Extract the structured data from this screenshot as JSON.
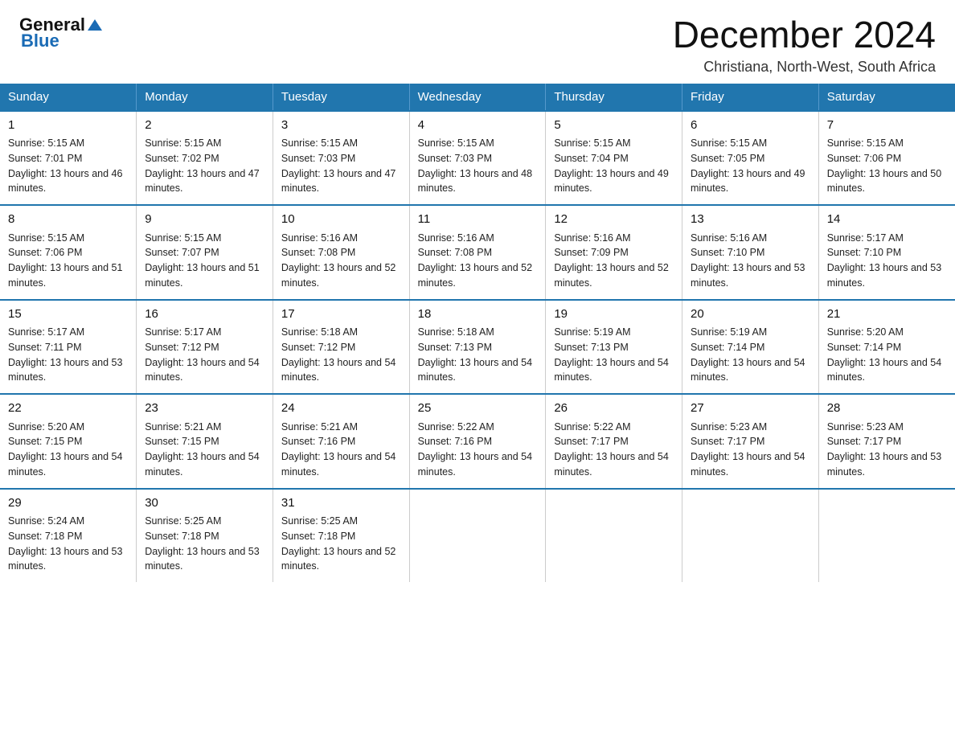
{
  "header": {
    "logo_general": "General",
    "logo_blue": "Blue",
    "title": "December 2024",
    "subtitle": "Christiana, North-West, South Africa"
  },
  "calendar": {
    "days_of_week": [
      "Sunday",
      "Monday",
      "Tuesday",
      "Wednesday",
      "Thursday",
      "Friday",
      "Saturday"
    ],
    "weeks": [
      [
        {
          "day": "1",
          "sunrise": "5:15 AM",
          "sunset": "7:01 PM",
          "daylight": "13 hours and 46 minutes."
        },
        {
          "day": "2",
          "sunrise": "5:15 AM",
          "sunset": "7:02 PM",
          "daylight": "13 hours and 47 minutes."
        },
        {
          "day": "3",
          "sunrise": "5:15 AM",
          "sunset": "7:03 PM",
          "daylight": "13 hours and 47 minutes."
        },
        {
          "day": "4",
          "sunrise": "5:15 AM",
          "sunset": "7:03 PM",
          "daylight": "13 hours and 48 minutes."
        },
        {
          "day": "5",
          "sunrise": "5:15 AM",
          "sunset": "7:04 PM",
          "daylight": "13 hours and 49 minutes."
        },
        {
          "day": "6",
          "sunrise": "5:15 AM",
          "sunset": "7:05 PM",
          "daylight": "13 hours and 49 minutes."
        },
        {
          "day": "7",
          "sunrise": "5:15 AM",
          "sunset": "7:06 PM",
          "daylight": "13 hours and 50 minutes."
        }
      ],
      [
        {
          "day": "8",
          "sunrise": "5:15 AM",
          "sunset": "7:06 PM",
          "daylight": "13 hours and 51 minutes."
        },
        {
          "day": "9",
          "sunrise": "5:15 AM",
          "sunset": "7:07 PM",
          "daylight": "13 hours and 51 minutes."
        },
        {
          "day": "10",
          "sunrise": "5:16 AM",
          "sunset": "7:08 PM",
          "daylight": "13 hours and 52 minutes."
        },
        {
          "day": "11",
          "sunrise": "5:16 AM",
          "sunset": "7:08 PM",
          "daylight": "13 hours and 52 minutes."
        },
        {
          "day": "12",
          "sunrise": "5:16 AM",
          "sunset": "7:09 PM",
          "daylight": "13 hours and 52 minutes."
        },
        {
          "day": "13",
          "sunrise": "5:16 AM",
          "sunset": "7:10 PM",
          "daylight": "13 hours and 53 minutes."
        },
        {
          "day": "14",
          "sunrise": "5:17 AM",
          "sunset": "7:10 PM",
          "daylight": "13 hours and 53 minutes."
        }
      ],
      [
        {
          "day": "15",
          "sunrise": "5:17 AM",
          "sunset": "7:11 PM",
          "daylight": "13 hours and 53 minutes."
        },
        {
          "day": "16",
          "sunrise": "5:17 AM",
          "sunset": "7:12 PM",
          "daylight": "13 hours and 54 minutes."
        },
        {
          "day": "17",
          "sunrise": "5:18 AM",
          "sunset": "7:12 PM",
          "daylight": "13 hours and 54 minutes."
        },
        {
          "day": "18",
          "sunrise": "5:18 AM",
          "sunset": "7:13 PM",
          "daylight": "13 hours and 54 minutes."
        },
        {
          "day": "19",
          "sunrise": "5:19 AM",
          "sunset": "7:13 PM",
          "daylight": "13 hours and 54 minutes."
        },
        {
          "day": "20",
          "sunrise": "5:19 AM",
          "sunset": "7:14 PM",
          "daylight": "13 hours and 54 minutes."
        },
        {
          "day": "21",
          "sunrise": "5:20 AM",
          "sunset": "7:14 PM",
          "daylight": "13 hours and 54 minutes."
        }
      ],
      [
        {
          "day": "22",
          "sunrise": "5:20 AM",
          "sunset": "7:15 PM",
          "daylight": "13 hours and 54 minutes."
        },
        {
          "day": "23",
          "sunrise": "5:21 AM",
          "sunset": "7:15 PM",
          "daylight": "13 hours and 54 minutes."
        },
        {
          "day": "24",
          "sunrise": "5:21 AM",
          "sunset": "7:16 PM",
          "daylight": "13 hours and 54 minutes."
        },
        {
          "day": "25",
          "sunrise": "5:22 AM",
          "sunset": "7:16 PM",
          "daylight": "13 hours and 54 minutes."
        },
        {
          "day": "26",
          "sunrise": "5:22 AM",
          "sunset": "7:17 PM",
          "daylight": "13 hours and 54 minutes."
        },
        {
          "day": "27",
          "sunrise": "5:23 AM",
          "sunset": "7:17 PM",
          "daylight": "13 hours and 54 minutes."
        },
        {
          "day": "28",
          "sunrise": "5:23 AM",
          "sunset": "7:17 PM",
          "daylight": "13 hours and 53 minutes."
        }
      ],
      [
        {
          "day": "29",
          "sunrise": "5:24 AM",
          "sunset": "7:18 PM",
          "daylight": "13 hours and 53 minutes."
        },
        {
          "day": "30",
          "sunrise": "5:25 AM",
          "sunset": "7:18 PM",
          "daylight": "13 hours and 53 minutes."
        },
        {
          "day": "31",
          "sunrise": "5:25 AM",
          "sunset": "7:18 PM",
          "daylight": "13 hours and 52 minutes."
        },
        null,
        null,
        null,
        null
      ]
    ]
  }
}
